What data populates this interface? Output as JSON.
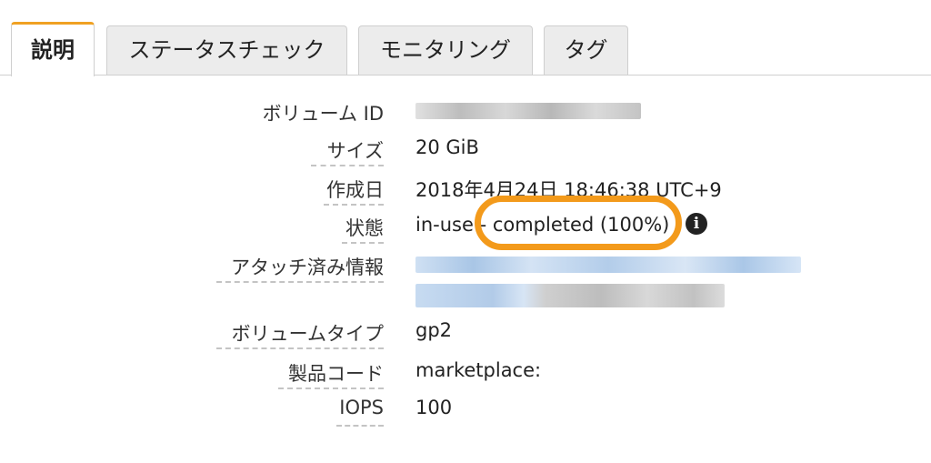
{
  "tabs": [
    {
      "label": "説明",
      "active": true
    },
    {
      "label": "ステータスチェック",
      "active": false
    },
    {
      "label": "モニタリング",
      "active": false
    },
    {
      "label": "タグ",
      "active": false
    }
  ],
  "details": {
    "volume_id": {
      "label": "ボリューム ID",
      "value": ""
    },
    "size": {
      "label": "サイズ",
      "value": "20 GiB"
    },
    "created": {
      "label": "作成日",
      "value": "2018年4月24日 18:46:38 UTC+9"
    },
    "state": {
      "label": "状態",
      "value": "in-use - completed (100%)"
    },
    "attachment": {
      "label": "アタッチ済み情報",
      "value": ""
    },
    "volume_type": {
      "label": "ボリュームタイプ",
      "value": "gp2"
    },
    "product_code": {
      "label": "製品コード",
      "value": "marketplace:"
    },
    "iops": {
      "label": "IOPS",
      "value": "100"
    }
  },
  "icons": {
    "state_info": "info-icon"
  },
  "colors": {
    "tab_active_accent": "#f0a122",
    "highlight_ring": "#f39a1b"
  }
}
